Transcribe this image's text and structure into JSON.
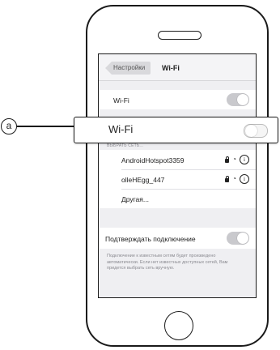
{
  "navbar": {
    "back_label": "Настройки",
    "title": "Wi-Fi"
  },
  "wifi_cell": {
    "label": "Wi-Fi",
    "toggle_on": false
  },
  "networks_header": "ВЫБРАТЬ СЕТЬ...",
  "networks": [
    {
      "name": "AndroidHotspot3359",
      "secured": true
    },
    {
      "name": "olleHEgg_447",
      "secured": true
    },
    {
      "name": "Другая..."
    }
  ],
  "ask_to_join": {
    "label": "Подтверждать подключение",
    "toggle_on": false
  },
  "ask_to_join_note": "Подключение к известным сетям будет произведено автоматически. Если нет известных доступных сетей, Вам придется выбрать сеть вручную.",
  "callout": {
    "marker": "a",
    "label": "Wi-Fi",
    "toggle_on": false
  },
  "icons": {
    "lock": "lock-icon",
    "wifi": "wifi-signal-icon",
    "info": "info-icon"
  }
}
